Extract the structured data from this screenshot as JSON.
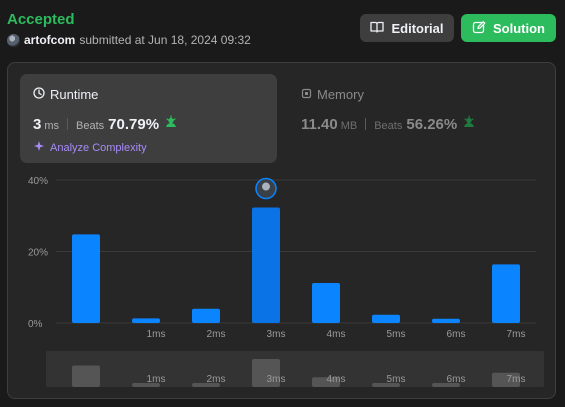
{
  "header": {
    "status": "Accepted",
    "username": "artofcom",
    "submitted_text": "submitted at Jun 18, 2024 09:32",
    "editorial_label": "Editorial",
    "solution_label": "Solution"
  },
  "runtime": {
    "title": "Runtime",
    "value": "3",
    "unit": "ms",
    "beats_label": "Beats",
    "beats_value": "70.79%",
    "analyze_label": "Analyze Complexity"
  },
  "memory": {
    "title": "Memory",
    "value": "11.40",
    "unit": "MB",
    "beats_label": "Beats",
    "beats_value": "56.26%"
  },
  "colors": {
    "accepted": "#2cbb5d",
    "bar": "#0a84ff",
    "bar_highlight": "#0a73e6",
    "purple": "#a78bfa"
  },
  "chart_data": {
    "type": "bar",
    "categories": [
      "",
      "1ms",
      "2ms",
      "3ms",
      "4ms",
      "5ms",
      "6ms",
      "7ms"
    ],
    "values": [
      24.8,
      1.3,
      4.0,
      32.3,
      11.2,
      2.3,
      1.2,
      16.4
    ],
    "ylim": [
      0,
      40
    ],
    "yticks": [
      "0%",
      "20%",
      "40%"
    ],
    "highlight_index": 3,
    "grid": true
  },
  "navigator": {
    "labels": [
      "1ms",
      "2ms",
      "3ms",
      "4ms",
      "5ms",
      "6ms",
      "7ms"
    ]
  }
}
